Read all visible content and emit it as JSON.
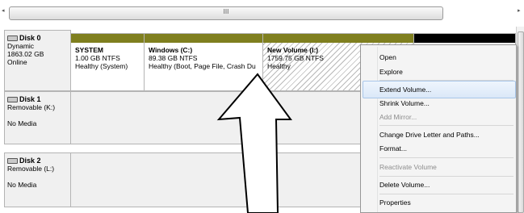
{
  "scrollbar": {
    "left_arrow": "◂",
    "right_arrow": "▸",
    "grip": "III"
  },
  "disks": [
    {
      "name": "Disk 0",
      "lines": [
        "Dynamic",
        "1863.02 GB",
        "Online"
      ],
      "partitions": [
        {
          "name": "SYSTEM",
          "size": "1.00 GB NTFS",
          "status": "Healthy (System)"
        },
        {
          "name": "Windows  (C:)",
          "size": "89.38 GB NTFS",
          "status": "Healthy (Boot, Page File, Crash Du"
        },
        {
          "name": "New Volume  (I:)",
          "size": "1759.75 GB NTFS",
          "status": "Healthy"
        },
        {
          "name": "",
          "size": "",
          "status": ""
        }
      ]
    },
    {
      "name": "Disk 1",
      "lines": [
        "Removable (K:)",
        "No Media"
      ]
    },
    {
      "name": "Disk 2",
      "lines": [
        "Removable (L:)",
        "No Media"
      ]
    }
  ],
  "context_menu": {
    "items": [
      {
        "label": "Open",
        "enabled": true
      },
      {
        "label": "Explore",
        "enabled": true
      },
      {
        "label": "Extend Volume...",
        "enabled": true,
        "highlighted": true
      },
      {
        "label": "Shrink Volume...",
        "enabled": true
      },
      {
        "label": "Add Mirror...",
        "enabled": false
      },
      {
        "label": "Change Drive Letter and Paths...",
        "enabled": true
      },
      {
        "label": "Format...",
        "enabled": true
      },
      {
        "label": "Reactivate Volume",
        "enabled": false
      },
      {
        "label": "Delete Volume...",
        "enabled": true
      },
      {
        "label": "Properties",
        "enabled": true
      }
    ]
  },
  "colors": {
    "partition_bar": "#7f7f1f",
    "unallocated_bar": "#000000",
    "menu_highlight": "#dbe8f8",
    "annotation_arrow": "#ffffff"
  },
  "annotation": {
    "icon": "up-arrow-icon"
  }
}
